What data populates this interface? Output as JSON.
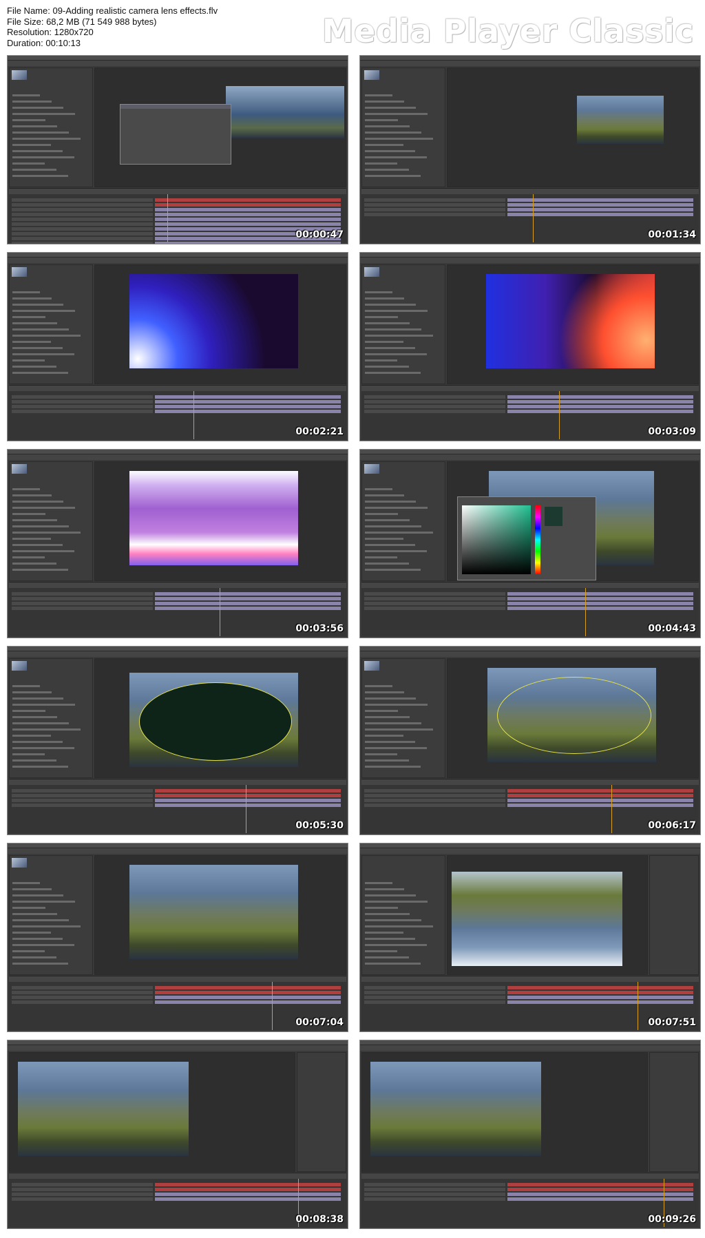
{
  "info": {
    "file_name": "File Name: 09-Adding realistic camera lens effects.flv",
    "file_size": "File Size: 68,2 MB (71 549 988 bytes)",
    "resolution": "Resolution: 1280x720",
    "duration": "Duration: 00:10:13"
  },
  "player_title": "Media Player Classic",
  "thumbnails": [
    {
      "timestamp": "00:00:47",
      "scene": "dialog"
    },
    {
      "timestamp": "00:01:34",
      "scene": "small-landscape"
    },
    {
      "timestamp": "00:02:21",
      "scene": "gradient"
    },
    {
      "timestamp": "00:03:09",
      "scene": "gradient2"
    },
    {
      "timestamp": "00:03:56",
      "scene": "glow"
    },
    {
      "timestamp": "00:04:43",
      "scene": "color-picker"
    },
    {
      "timestamp": "00:05:30",
      "scene": "dark-ellipse"
    },
    {
      "timestamp": "00:06:17",
      "scene": "ellipse-outline"
    },
    {
      "timestamp": "00:07:04",
      "scene": "landscape"
    },
    {
      "timestamp": "00:07:51",
      "scene": "flipped"
    },
    {
      "timestamp": "00:08:38",
      "scene": "landscape-effects"
    },
    {
      "timestamp": "00:09:26",
      "scene": "landscape-effects2"
    }
  ],
  "colors": {
    "ui_bg": "#3a3a3a",
    "timeline_red": "#b04040",
    "timeline_purple": "#8a84aa",
    "mask_yellow": "#e5e34a",
    "playhead": "#d8a020"
  }
}
